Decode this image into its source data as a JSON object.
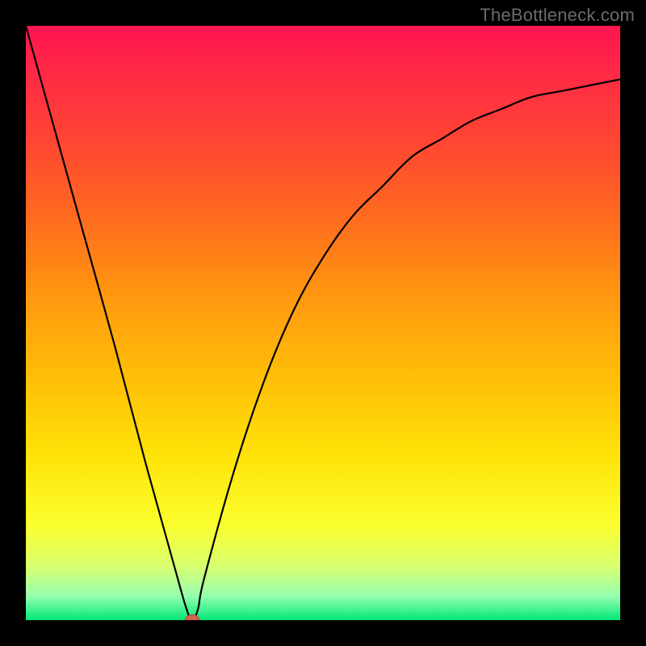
{
  "watermark": "TheBottleneck.com",
  "colors": {
    "frame": "#000000",
    "curve": "#000000",
    "marker_fill": "#d2654b",
    "marker_stroke": "#b24d36"
  },
  "chart_data": {
    "type": "line",
    "title": "",
    "xlabel": "",
    "ylabel": "",
    "xlim": [
      0,
      100
    ],
    "ylim": [
      0,
      100
    ],
    "grid": false,
    "series": [
      {
        "name": "curve",
        "x": [
          0,
          5,
          10,
          15,
          20,
          25,
          27,
          28,
          29,
          30,
          35,
          40,
          45,
          50,
          55,
          60,
          65,
          70,
          75,
          80,
          85,
          90,
          95,
          100
        ],
        "y": [
          100,
          82,
          64,
          46,
          27,
          9,
          2,
          0,
          2,
          7,
          25,
          40,
          52,
          61,
          68,
          73,
          78,
          81,
          84,
          86,
          88,
          89,
          90,
          91
        ]
      }
    ],
    "marker": {
      "x": 28,
      "y": 0,
      "rx": 1.2,
      "ry": 0.9
    }
  }
}
